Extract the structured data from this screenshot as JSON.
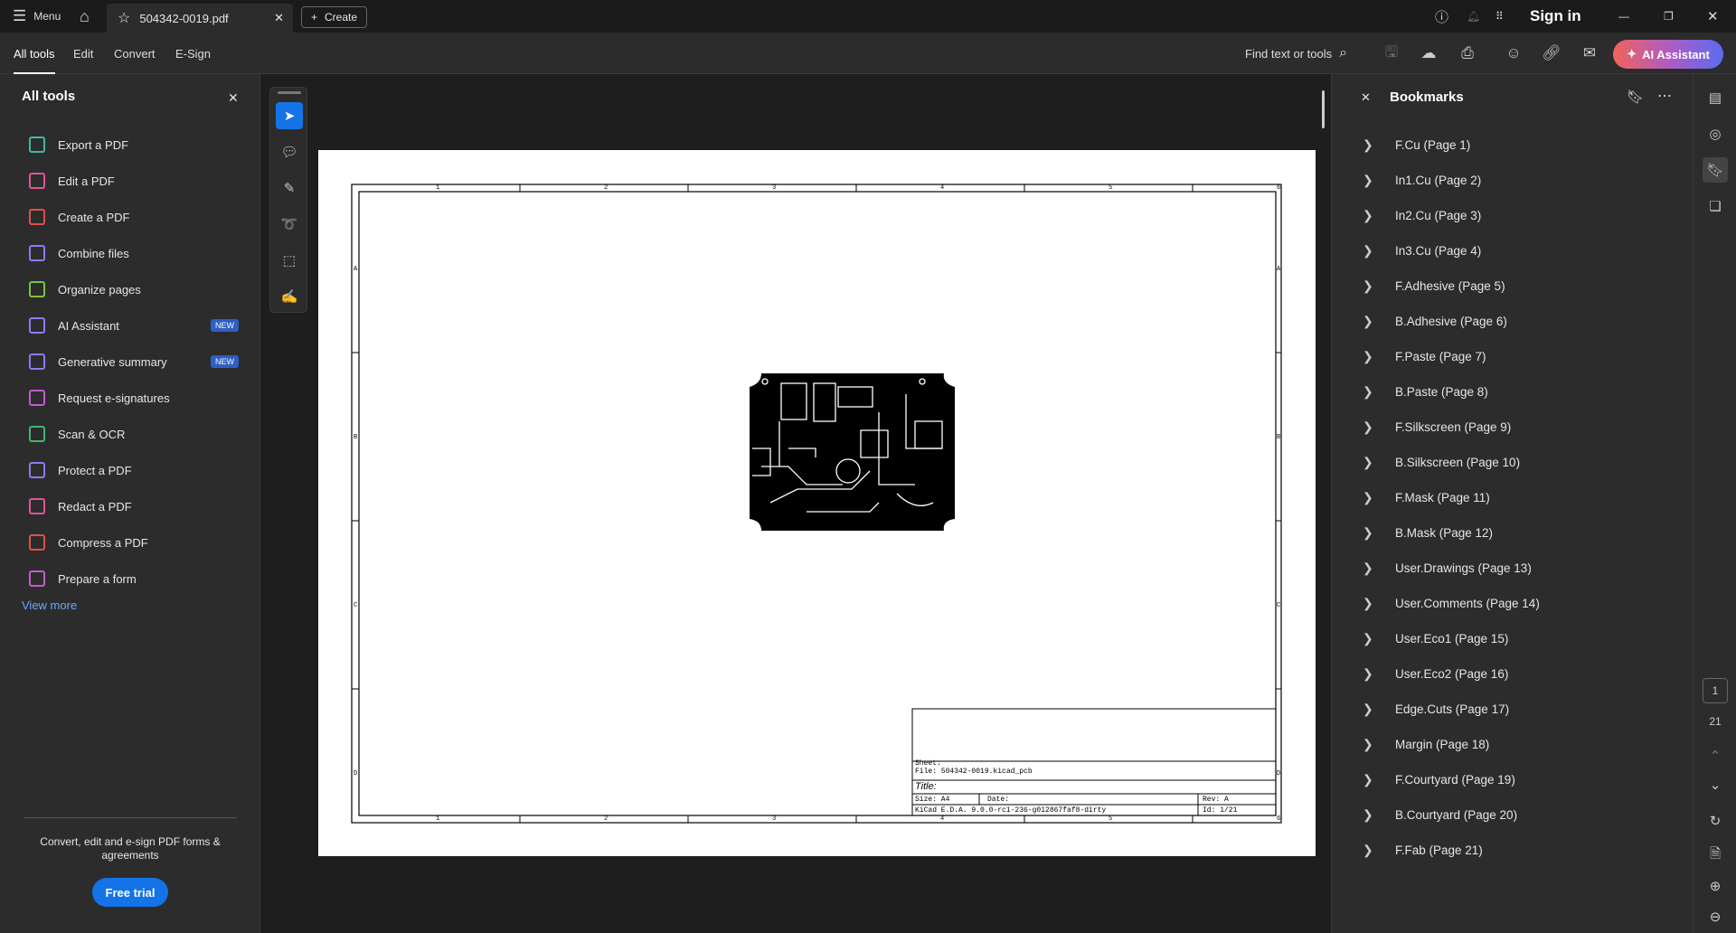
{
  "titlebar": {
    "menu": "Menu",
    "tab_title": "504342-0019.pdf",
    "create": "Create",
    "sign_in": "Sign in"
  },
  "toolbar": {
    "tabs": [
      "All tools",
      "Edit",
      "Convert",
      "E-Sign"
    ],
    "find": "Find text or tools",
    "ai_assistant": "AI Assistant"
  },
  "left_panel": {
    "title": "All tools",
    "tools": [
      {
        "label": "Export a PDF",
        "color": "#3fb8a6"
      },
      {
        "label": "Edit a PDF",
        "color": "#e0559a"
      },
      {
        "label": "Create a PDF",
        "color": "#e0504a"
      },
      {
        "label": "Combine files",
        "color": "#8a7cf2"
      },
      {
        "label": "Organize pages",
        "color": "#7cc242"
      },
      {
        "label": "AI Assistant",
        "color": "#8a7cf2",
        "badge": "NEW"
      },
      {
        "label": "Generative summary",
        "color": "#8a7cf2",
        "badge": "NEW"
      },
      {
        "label": "Request e-signatures",
        "color": "#c45ad0"
      },
      {
        "label": "Scan & OCR",
        "color": "#3fb870"
      },
      {
        "label": "Protect a PDF",
        "color": "#8a7cf2"
      },
      {
        "label": "Redact a PDF",
        "color": "#e0559a"
      },
      {
        "label": "Compress a PDF",
        "color": "#e0504a"
      },
      {
        "label": "Prepare a form",
        "color": "#c45ad0"
      }
    ],
    "view_more": "View more",
    "promo": "Convert, edit and e-sign PDF forms & agreements",
    "free_trial": "Free trial"
  },
  "document": {
    "sheet": "Sheet:",
    "file": "File: 504342-0019.kicad_pcb",
    "title": "Title:",
    "size": "Size: A4",
    "date": "Date:",
    "rev": "Rev: A",
    "generator": "KiCad E.D.A. 9.0.0-rc1-236-g012867faf8-dirty",
    "id": "Id: 1/21",
    "col_labels": [
      "1",
      "2",
      "3",
      "4",
      "5",
      "6"
    ],
    "row_labels": [
      "A",
      "B",
      "C",
      "D"
    ]
  },
  "bookmarks": {
    "title": "Bookmarks",
    "items": [
      "F.Cu (Page 1)",
      "In1.Cu (Page 2)",
      "In2.Cu (Page 3)",
      "In3.Cu (Page 4)",
      "F.Adhesive (Page 5)",
      "B.Adhesive (Page 6)",
      "F.Paste (Page 7)",
      "B.Paste (Page 8)",
      "F.Silkscreen (Page 9)",
      "B.Silkscreen (Page 10)",
      "F.Mask (Page 11)",
      "B.Mask (Page 12)",
      "User.Drawings (Page 13)",
      "User.Comments (Page 14)",
      "User.Eco1 (Page 15)",
      "User.Eco2 (Page 16)",
      "Edge.Cuts (Page 17)",
      "Margin (Page 18)",
      "F.Courtyard (Page 19)",
      "B.Courtyard (Page 20)",
      "F.Fab (Page 21)"
    ]
  },
  "pagination": {
    "current": "1",
    "total": "21"
  }
}
